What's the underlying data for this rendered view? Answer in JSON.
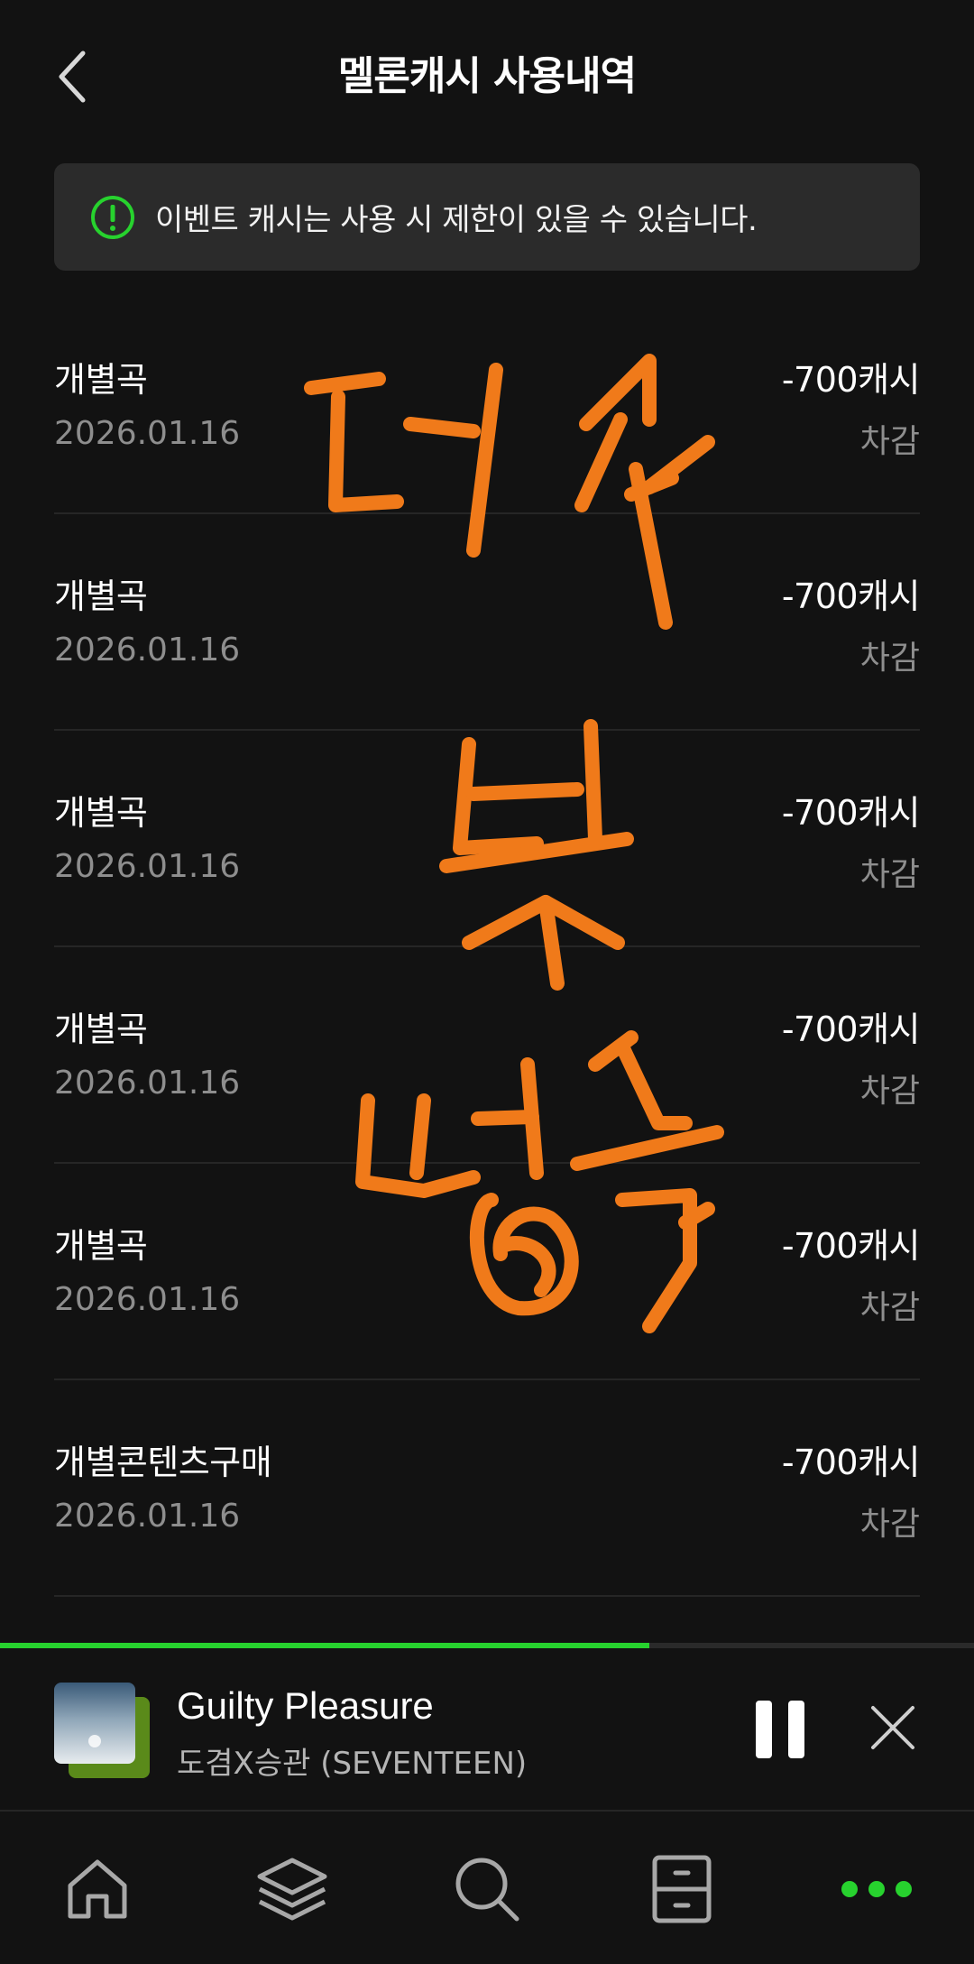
{
  "header": {
    "title": "멜론캐시 사용내역"
  },
  "notice": {
    "text": "이벤트 캐시는 사용 시 제한이 있을 수 있습니다."
  },
  "transactions": [
    {
      "title": "개별곡",
      "date": "2026.01.16",
      "amount": "-700캐시",
      "status": "차감"
    },
    {
      "title": "개별곡",
      "date": "2026.01.16",
      "amount": "-700캐시",
      "status": "차감"
    },
    {
      "title": "개별곡",
      "date": "2026.01.16",
      "amount": "-700캐시",
      "status": "차감"
    },
    {
      "title": "개별곡",
      "date": "2026.01.16",
      "amount": "-700캐시",
      "status": "차감"
    },
    {
      "title": "개별곡",
      "date": "2026.01.16",
      "amount": "-700캐시",
      "status": "차감"
    },
    {
      "title": "개별콘텐츠구매",
      "date": "2026.01.16",
      "amount": "-700캐시",
      "status": "차감"
    }
  ],
  "handwriting": {
    "text": "더쿠 뽀영축"
  },
  "player": {
    "song_title": "Guilty Pleasure",
    "artist": "도겸X승관 (SEVENTEEN)",
    "progress": 0.667
  },
  "nav": {
    "items": [
      {
        "icon": "home-icon"
      },
      {
        "icon": "layers-icon"
      },
      {
        "icon": "search-icon"
      },
      {
        "icon": "drawer-icon"
      },
      {
        "icon": "more-icon"
      }
    ]
  },
  "colors": {
    "accent": "#27d22e",
    "background": "#121212",
    "notice_bg": "#2b2b2b",
    "scribble": "#f07a1a",
    "secondary_text": "#8e8e8e"
  }
}
